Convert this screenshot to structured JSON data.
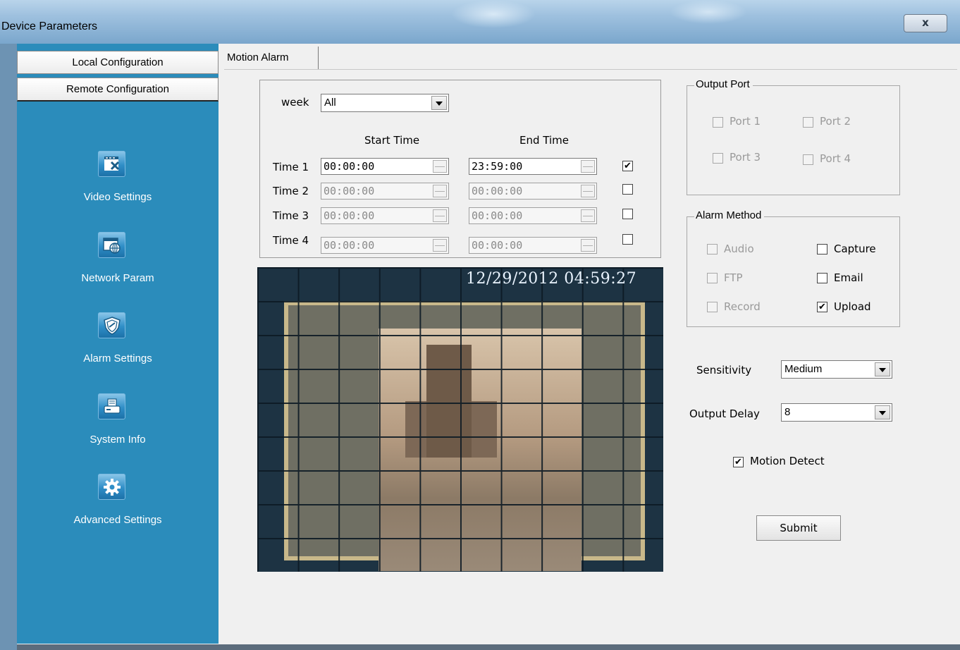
{
  "window": {
    "title": "Device Parameters",
    "close_label": "x"
  },
  "sidebar": {
    "local_label": "Local Configuration",
    "remote_label": "Remote Configuration",
    "items": [
      {
        "label": "Video Settings",
        "icon": "video-settings-icon"
      },
      {
        "label": "Network Param",
        "icon": "network-icon"
      },
      {
        "label": "Alarm Settings",
        "icon": "shield-icon"
      },
      {
        "label": "System Info",
        "icon": "printer-icon"
      },
      {
        "label": "Advanced Settings",
        "icon": "gear-icon"
      }
    ]
  },
  "tab": {
    "label": "Motion Alarm"
  },
  "schedule": {
    "week_label": "week",
    "week_value": "All",
    "start_header": "Start Time",
    "end_header": "End Time",
    "rows": [
      {
        "label": "Time 1",
        "start": "00:00:00",
        "end": "23:59:00",
        "checked": true,
        "check_mark": "✔"
      },
      {
        "label": "Time 2",
        "start": "00:00:00",
        "end": "00:00:00",
        "checked": false,
        "check_mark": ""
      },
      {
        "label": "Time 3",
        "start": "00:00:00",
        "end": "00:00:00",
        "checked": false,
        "check_mark": ""
      },
      {
        "label": "Time 4",
        "start": "00:00:00",
        "end": "00:00:00",
        "checked": false,
        "check_mark": ""
      }
    ]
  },
  "video": {
    "timestamp": "12/29/2012 04:59:27"
  },
  "output_port": {
    "title": "Output Port",
    "ports": [
      {
        "label": "Port 1"
      },
      {
        "label": "Port 2"
      },
      {
        "label": "Port 3"
      },
      {
        "label": "Port 4"
      }
    ]
  },
  "alarm_method": {
    "title": "Alarm Method",
    "audio": "Audio",
    "ftp": "FTP",
    "record": "Record",
    "capture": "Capture",
    "email": "Email",
    "upload": "Upload",
    "upload_mark": "✔"
  },
  "sensitivity": {
    "label": "Sensitivity",
    "value": "Medium"
  },
  "output_delay": {
    "label": "Output Delay",
    "value": "8"
  },
  "motion_detect": {
    "label": "Motion Detect",
    "mark": "✔"
  },
  "submit_label": "Submit"
}
